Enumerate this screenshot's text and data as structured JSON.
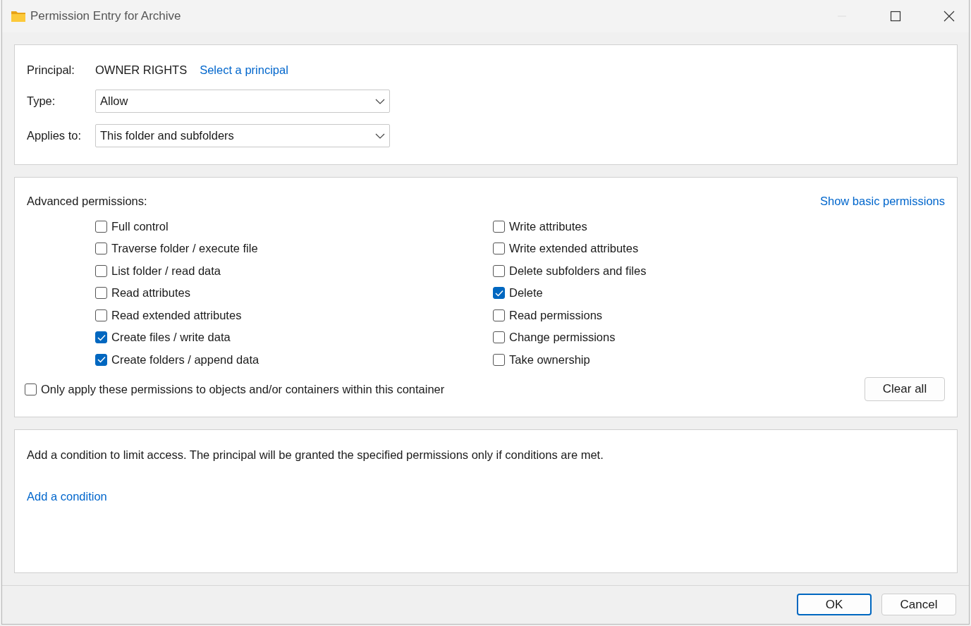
{
  "window": {
    "title": "Permission Entry for Archive"
  },
  "principal": {
    "label": "Principal:",
    "value": "OWNER RIGHTS",
    "link": "Select a principal"
  },
  "type": {
    "label": "Type:",
    "value": "Allow"
  },
  "applies_to": {
    "label": "Applies to:",
    "value": "This folder and subfolders"
  },
  "permissions": {
    "heading": "Advanced permissions:",
    "toggle_link": "Show basic permissions",
    "columns": [
      {
        "items": [
          {
            "label": "Full control",
            "checked": false
          },
          {
            "label": "Traverse folder / execute file",
            "checked": false
          },
          {
            "label": "List folder / read data",
            "checked": false
          },
          {
            "label": "Read attributes",
            "checked": false
          },
          {
            "label": "Read extended attributes",
            "checked": false
          },
          {
            "label": "Create files / write data",
            "checked": true
          },
          {
            "label": "Create folders / append data",
            "checked": true
          }
        ]
      },
      {
        "items": [
          {
            "label": "Write attributes",
            "checked": false
          },
          {
            "label": "Write extended attributes",
            "checked": false
          },
          {
            "label": "Delete subfolders and files",
            "checked": false
          },
          {
            "label": "Delete",
            "checked": true
          },
          {
            "label": "Read permissions",
            "checked": false
          },
          {
            "label": "Change permissions",
            "checked": false
          },
          {
            "label": "Take ownership",
            "checked": false
          }
        ]
      }
    ]
  },
  "only_apply": {
    "label": "Only apply these permissions to objects and/or containers within this container",
    "checked": false
  },
  "clear_all": "Clear all",
  "condition": {
    "text": "Add a condition to limit access. The principal will be granted the specified permissions only if conditions are met.",
    "link": "Add a condition"
  },
  "buttons": [
    {
      "label": "OK",
      "default": true
    },
    {
      "label": "Cancel",
      "default": false
    }
  ]
}
